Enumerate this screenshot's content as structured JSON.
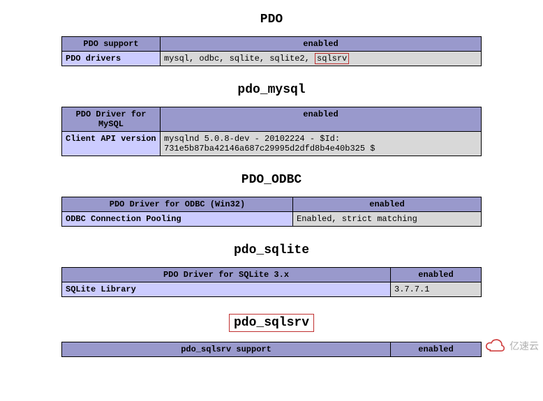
{
  "pdo": {
    "title": "PDO",
    "header_left": "PDO support",
    "header_right": "enabled",
    "row_label": "PDO drivers",
    "drivers_prefix": "mysql, odbc, sqlite, sqlite2, ",
    "drivers_boxed": "sqlsrv"
  },
  "pdo_mysql": {
    "title": "pdo_mysql",
    "header_left": "PDO Driver for MySQL",
    "header_right": "enabled",
    "row_label": "Client API version",
    "row_value": "mysqlnd 5.0.8-dev - 20102224 - $Id: 731e5b87ba42146a687c29995d2dfd8b4e40b325 $"
  },
  "pdo_odbc": {
    "title": "PDO_ODBC",
    "header_left": "PDO Driver for ODBC (Win32)",
    "header_right": "enabled",
    "row_label": "ODBC Connection Pooling",
    "row_value": "Enabled, strict matching"
  },
  "pdo_sqlite": {
    "title": "pdo_sqlite",
    "header_left": "PDO Driver for SQLite 3.x",
    "header_right": "enabled",
    "row_label": "SQLite Library",
    "row_value": "3.7.7.1"
  },
  "pdo_sqlsrv": {
    "title": "pdo_sqlsrv",
    "header_left": "pdo_sqlsrv support",
    "header_right": "enabled"
  },
  "watermark": {
    "text": "亿速云"
  }
}
